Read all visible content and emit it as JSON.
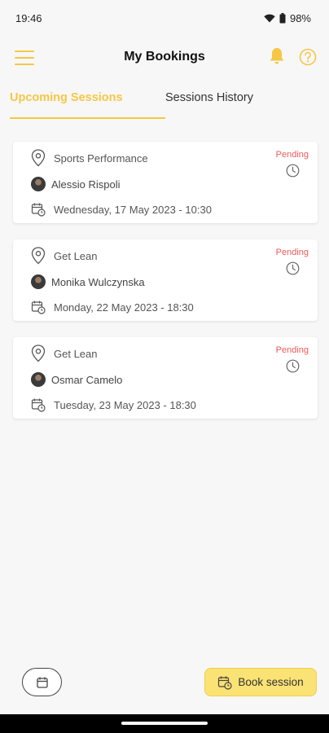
{
  "status_bar": {
    "time": "19:46",
    "battery": "98%"
  },
  "header": {
    "title": "My Bookings"
  },
  "tabs": [
    {
      "label": "Upcoming Sessions",
      "active": true
    },
    {
      "label": "Sessions History",
      "active": false
    }
  ],
  "bookings": [
    {
      "session": "Sports Performance",
      "trainer": "Alessio Rispoli",
      "datetime": "Wednesday, 17 May 2023 - 10:30",
      "status": "Pending"
    },
    {
      "session": "Get Lean",
      "trainer": "Monika Wulczynska",
      "datetime": "Monday, 22 May 2023 - 18:30",
      "status": "Pending"
    },
    {
      "session": "Get Lean",
      "trainer": "Osmar Camelo",
      "datetime": "Tuesday, 23 May 2023 - 18:30",
      "status": "Pending"
    }
  ],
  "footer": {
    "book_label": "Book session"
  },
  "icons": {
    "menu": "hamburger-menu-icon",
    "bell": "bell-icon",
    "help": "help-icon",
    "location": "location-pin-icon",
    "calendar": "calendar-clock-icon",
    "clock": "clock-icon"
  },
  "colors": {
    "accent": "#f6c744",
    "pending": "#ee5a5a",
    "button": "#fbe274"
  }
}
